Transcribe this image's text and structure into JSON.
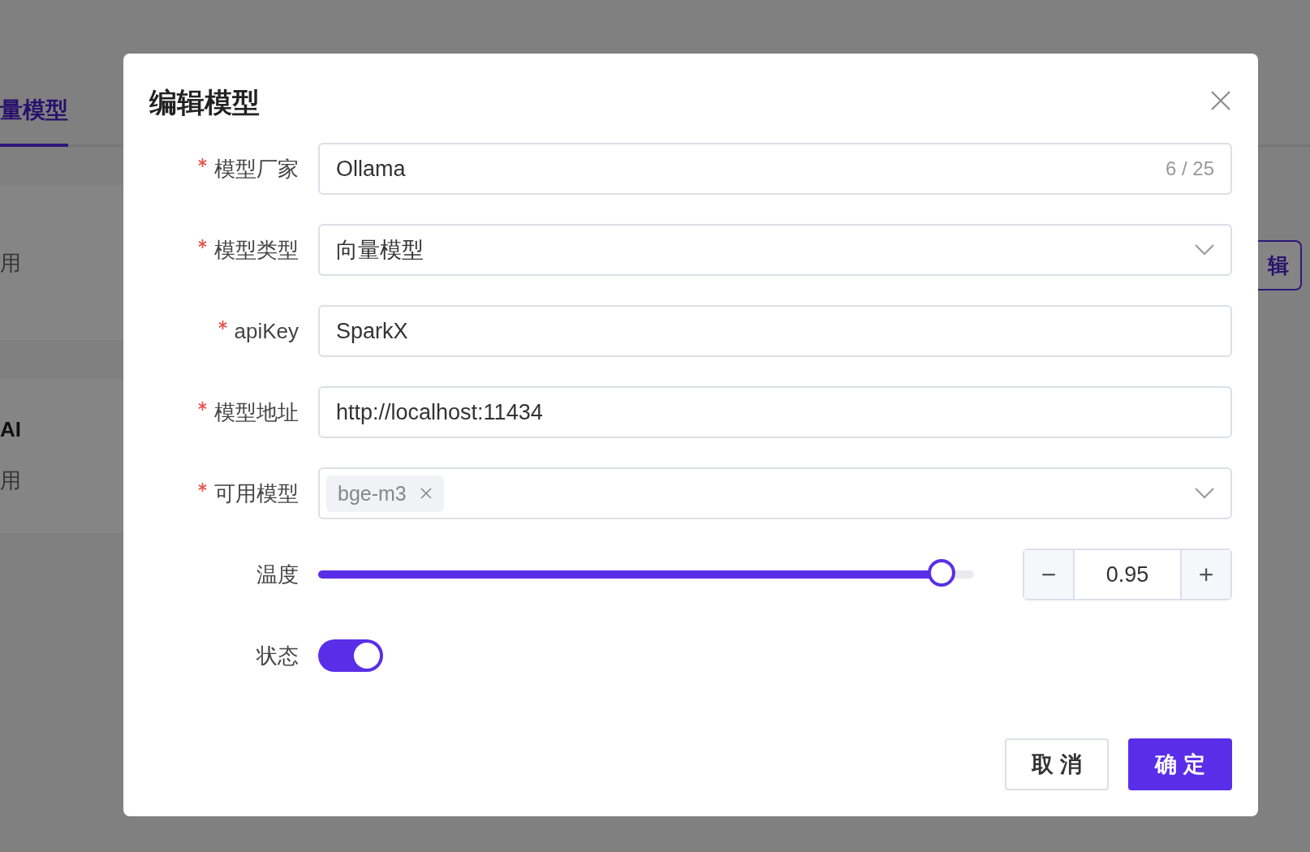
{
  "background": {
    "tabs": [
      {
        "label": "量模型",
        "selected": true
      }
    ],
    "texts": [
      "用",
      "AI",
      "用"
    ],
    "edit_button": "辑"
  },
  "dialog": {
    "title": "编辑模型",
    "fields": [
      {
        "kind": "text",
        "label": "模型厂家",
        "required": true,
        "value": "Ollama",
        "counter": "6 / 25"
      },
      {
        "kind": "select",
        "label": "模型类型",
        "required": true,
        "value": "向量模型"
      },
      {
        "kind": "text",
        "label": "apiKey",
        "required": true,
        "value": "SparkX"
      },
      {
        "kind": "text",
        "label": "模型地址",
        "required": true,
        "value": "http://localhost:11434"
      },
      {
        "kind": "tags",
        "label": "可用模型",
        "required": true,
        "tags": [
          "bge-m3"
        ]
      },
      {
        "kind": "slider",
        "label": "温度",
        "required": false,
        "level": 0.95,
        "value": "0.95",
        "minus": "−",
        "plus": "+"
      },
      {
        "kind": "switch",
        "label": "状态",
        "required": false,
        "on": true
      }
    ],
    "buttons": [
      {
        "kind": "secondary",
        "label": "取 消"
      },
      {
        "kind": "primary",
        "label": "确 定"
      }
    ]
  }
}
